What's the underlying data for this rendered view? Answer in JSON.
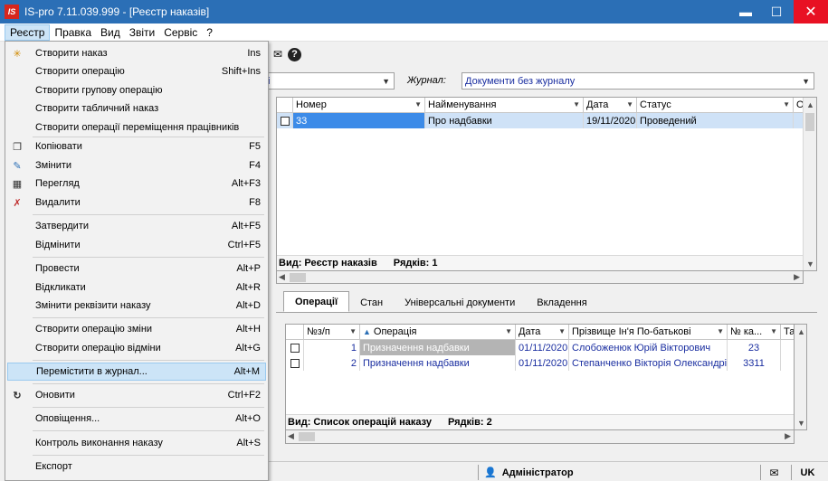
{
  "window": {
    "title": "IS-pro 7.11.039.999 - [Реєстр наказів]",
    "logo": "IS",
    "minimize": "▬",
    "maximize": "☐",
    "close": "✕"
  },
  "menubar": [
    "Реєстр",
    "Правка",
    "Вид",
    "Звіти",
    "Сервіс",
    "?"
  ],
  "dropdown": [
    {
      "label": "Створити наказ",
      "shortcut": "Ins",
      "icon": "new-doc-icon",
      "glyph": "✳"
    },
    {
      "label": "Створити операцію",
      "shortcut": "Shift+Ins",
      "icon": "",
      "glyph": ""
    },
    {
      "label": "Створити групову операцію",
      "shortcut": "",
      "icon": "",
      "glyph": ""
    },
    {
      "label": "Створити табличний наказ",
      "shortcut": "",
      "icon": "",
      "glyph": ""
    },
    {
      "label": "Створити операції переміщення працівників",
      "shortcut": "",
      "icon": "",
      "glyph": ""
    },
    {
      "label": "Копіювати",
      "shortcut": "F5",
      "icon": "copy-icon",
      "glyph": "❐"
    },
    {
      "label": "Змінити",
      "shortcut": "F4",
      "icon": "edit-icon",
      "glyph": "✎"
    },
    {
      "label": "Перегляд",
      "shortcut": "Alt+F3",
      "icon": "table-view-icon",
      "glyph": "▦"
    },
    {
      "label": "Видалити",
      "shortcut": "F8",
      "icon": "delete-icon",
      "glyph": "✗"
    },
    {
      "label": "Затвердити",
      "shortcut": "Alt+F5",
      "icon": "",
      "glyph": ""
    },
    {
      "label": "Відмінити",
      "shortcut": "Ctrl+F5",
      "icon": "",
      "glyph": ""
    },
    {
      "label": "Провести",
      "shortcut": "Alt+P",
      "icon": "",
      "glyph": ""
    },
    {
      "label": "Відкликати",
      "shortcut": "Alt+R",
      "icon": "",
      "glyph": ""
    },
    {
      "label": "Змінити реквізити наказу",
      "shortcut": "Alt+D",
      "icon": "",
      "glyph": ""
    },
    {
      "label": "Створити операцію зміни",
      "shortcut": "Alt+H",
      "icon": "",
      "glyph": ""
    },
    {
      "label": "Створити операцію відміни",
      "shortcut": "Alt+G",
      "icon": "",
      "glyph": ""
    },
    {
      "label": "Перемістити в журнал...",
      "shortcut": "Alt+M",
      "icon": "",
      "glyph": ""
    },
    {
      "label": "Оновити",
      "shortcut": "Ctrl+F2",
      "icon": "refresh-icon",
      "glyph": "↻"
    },
    {
      "label": "Оповіщення...",
      "shortcut": "Alt+O",
      "icon": "",
      "glyph": ""
    },
    {
      "label": "Контроль виконання наказу",
      "shortcut": "Alt+S",
      "icon": "",
      "glyph": ""
    },
    {
      "label": "Експорт",
      "shortcut": "",
      "icon": "",
      "glyph": ""
    }
  ],
  "filter": {
    "journal_label": "Журнал:",
    "journal_value": "Документи без журналу",
    "left_value": "і"
  },
  "orders_grid": {
    "columns": [
      "Номер",
      "Найменування",
      "Дата",
      "Статус",
      "О"
    ],
    "rows": [
      {
        "number": "33",
        "name": "Про надбавки",
        "date": "19/11/2020",
        "status": "Проведений"
      }
    ],
    "footer_view": "Вид: Реєстр наказів",
    "footer_rows": "Рядків: 1"
  },
  "tabs": [
    "Операції",
    "Стан",
    "Універсальні документи",
    "Вкладення"
  ],
  "operations_grid": {
    "columns": [
      "№з/п",
      "Операція",
      "Дата",
      "Прізвище Ін'я По-батькові",
      "№ ка...",
      "Та"
    ],
    "rows": [
      {
        "n": "1",
        "op": "Призначення надбавки",
        "date": "01/11/2020",
        "person": "Слобоженюк Юрій Вікторович",
        "card": "23"
      },
      {
        "n": "2",
        "op": "Призначення надбавки",
        "date": "01/11/2020",
        "person": "Степанченко Вікторія Олександрі...",
        "card": "3311"
      }
    ],
    "footer_view": "Вид: Список операцій наказу",
    "footer_rows": "Рядків: 2"
  },
  "statusbar": {
    "user": "Адміністратор",
    "lang": "UK"
  },
  "colors": {
    "titlebar": "#2b6fb6",
    "close": "#e81123",
    "highlight": "#cce4f7",
    "blue_text": "#1a2ea0"
  }
}
